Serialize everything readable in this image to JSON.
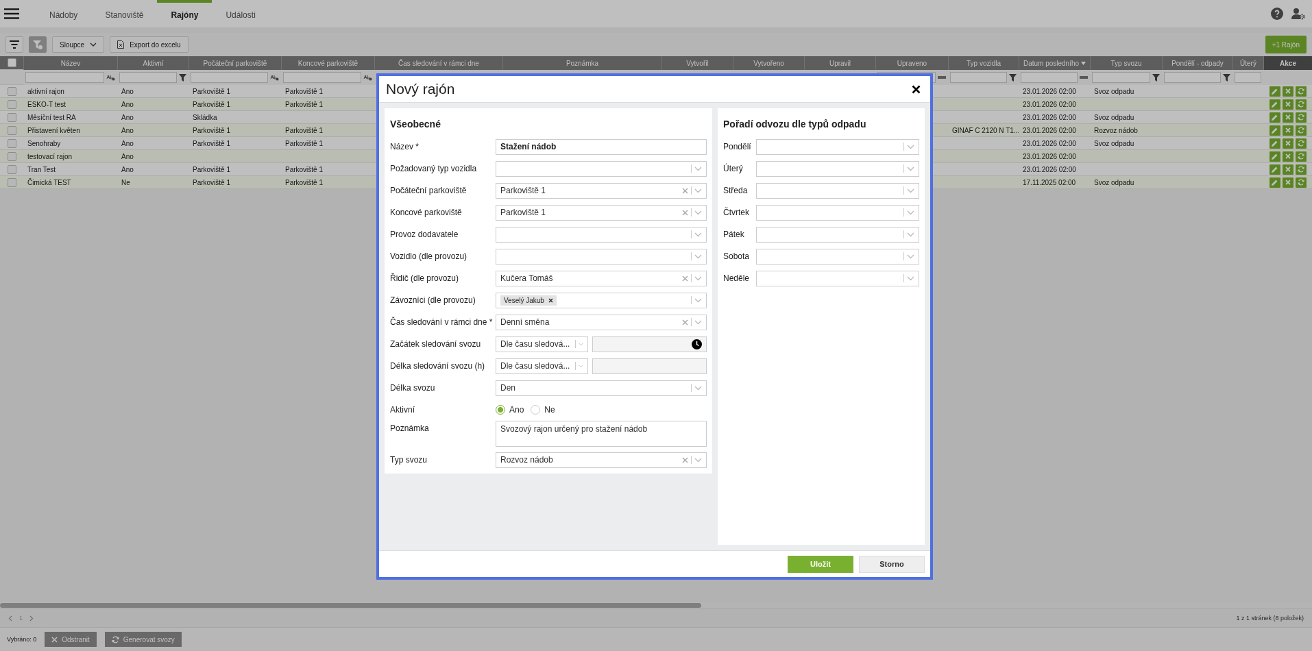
{
  "top_nav": {
    "tabs": [
      {
        "label": "Nádoby",
        "selected": false
      },
      {
        "label": "Stanoviště",
        "selected": false
      },
      {
        "label": "Rajóny",
        "selected": true
      },
      {
        "label": "Události",
        "selected": false
      }
    ]
  },
  "toolbar": {
    "clear_filter_disabled": true,
    "columns_button": "Sloupce",
    "export_button": "Export do excelu",
    "add_button": "+1 Rajón"
  },
  "table": {
    "select_all_checked": false,
    "columns": [
      {
        "label": "Název",
        "filter": {
          "kind": "text"
        }
      },
      {
        "label": "Aktivní",
        "filter": {
          "kind": "select"
        }
      },
      {
        "label": "Počáteční parkoviště",
        "filter": {
          "kind": "text"
        }
      },
      {
        "label": "Koncové parkoviště",
        "filter": {
          "kind": "text"
        }
      },
      {
        "label": "Čas sledování v rámci dne"
      },
      {
        "label": "Poznámka"
      },
      {
        "label": "Vytvořil"
      },
      {
        "label": "Vytvořeno"
      },
      {
        "label": "Upravil"
      },
      {
        "label": "Upraveno",
        "filter": {
          "kind": "date"
        }
      },
      {
        "label": "Typ vozidla",
        "filter": {
          "kind": "select"
        }
      },
      {
        "label": "Datum posledního",
        "filter": {
          "kind": "date"
        },
        "sorted_descending": true
      },
      {
        "label": "Typ svozu",
        "filter": {
          "kind": "select"
        }
      },
      {
        "label": "Pondělí - odpady",
        "filter": {
          "kind": "select"
        }
      },
      {
        "label": "Úterý",
        "filter": {
          "kind": "plain"
        }
      }
    ],
    "actions_label": "Akce",
    "rows": [
      {
        "checked": false,
        "name": "aktivní rajon",
        "active": "Ano",
        "start_parking": "Parkoviště 1",
        "end_parking": "Parkoviště 1",
        "last_date": "23.01.2026 02:00",
        "collection_type": "Svoz odpadu"
      },
      {
        "checked": false,
        "name": "ESKO-T test",
        "active": "Ano",
        "start_parking": "Parkoviště 1",
        "end_parking": "Parkoviště 1",
        "last_date": "23.01.2026 02:00"
      },
      {
        "checked": false,
        "name": "Měsíční test RA",
        "active": "Ano",
        "start_parking": "Skládka",
        "last_date": "23.01.2026 02:00",
        "collection_type": "Svoz odpadu"
      },
      {
        "checked": false,
        "name": "Přistavení květen",
        "active": "Ano",
        "start_parking": "Parkoviště 1",
        "end_parking": "Parkoviště 1",
        "vehicle_type": "GINAF C 2120 N T1...",
        "last_date": "23.01.2026 02:00",
        "collection_type": "Rozvoz nádob"
      },
      {
        "checked": false,
        "name": "Senohraby",
        "active": "Ano",
        "start_parking": "Parkoviště 1",
        "end_parking": "Parkoviště 1",
        "last_date": "23.01.2026 02:00",
        "collection_type": "Svoz odpadu"
      },
      {
        "checked": false,
        "name": "testovací rajon",
        "active": "Ano",
        "last_date": "23.01.2026 02:00"
      },
      {
        "checked": false,
        "name": "Tran Test",
        "active": "Ano",
        "start_parking": "Parkoviště 1",
        "end_parking": "Parkoviště 1",
        "last_date": "23.01.2026 02:00"
      },
      {
        "checked": false,
        "name": "Čimická TEST",
        "active": "Ne",
        "start_parking": "Parkoviště 1",
        "end_parking": "Parkoviště 1",
        "last_date": "17.11.2025 02:00",
        "collection_type": "Svoz odpadu"
      }
    ]
  },
  "pagination": {
    "page": "1",
    "summary": "1 z 1 stránek (8 položek)"
  },
  "footer": {
    "selected_label": "Vybráno: 0",
    "buttons": [
      {
        "label": "Odstranit",
        "kind": "delete",
        "disabled": true
      },
      {
        "label": "Generovat svozy",
        "kind": "generate",
        "disabled": true
      }
    ]
  },
  "modal": {
    "title": "Nový rajón",
    "sections": [
      {
        "title": "Všeobecné",
        "fields": [
          {
            "label": "Název *",
            "kind": "text",
            "value": "Stažení nádob"
          },
          {
            "label": "Požadovaný typ vozidla",
            "kind": "select"
          },
          {
            "label": "Počáteční parkoviště",
            "kind": "select",
            "value": "Parkoviště 1",
            "clearable": true
          },
          {
            "label": "Koncové parkoviště",
            "kind": "select",
            "value": "Parkoviště 1",
            "clearable": true
          },
          {
            "label": "Provoz dodavatele",
            "kind": "select"
          },
          {
            "label": "Vozidlo (dle provozu)",
            "kind": "select"
          },
          {
            "label": "Řidič (dle provozu)",
            "kind": "select",
            "value": "Kučera Tomáš",
            "clearable": true
          },
          {
            "label": "Závozníci (dle provozu)",
            "kind": "tags",
            "tags": [
              "Veselý Jakub"
            ]
          },
          {
            "label": "Čas sledování v rámci dne *",
            "kind": "select",
            "value": "Denní směna",
            "clearable": true
          },
          {
            "label": "Začátek sledování svozu",
            "kind": "time_split",
            "value": "Dle času sledová..."
          },
          {
            "label": "Délka sledování svozu (h)",
            "kind": "number_split",
            "value": "Dle času sledová..."
          },
          {
            "label": "Délka svozu",
            "kind": "select",
            "value": "Den",
            "clearable": false
          },
          {
            "label": "Aktivní",
            "kind": "radio",
            "options": [
              {
                "label": "Ano",
                "selected": true
              },
              {
                "label": "Ne",
                "selected": false
              }
            ]
          },
          {
            "label": "Poznámka",
            "kind": "textarea",
            "value": "Svozový rajon určený pro stažení nádob"
          },
          {
            "label": "Typ svozu",
            "kind": "select",
            "value": "Rozvoz nádob",
            "clearable": true
          }
        ]
      },
      {
        "title": "Pořadí odvozu dle typů odpadu",
        "fields": [
          {
            "label": "Pondělí",
            "kind": "select"
          },
          {
            "label": "Úterý",
            "kind": "select"
          },
          {
            "label": "Středa",
            "kind": "select"
          },
          {
            "label": "Čtvrtek",
            "kind": "select"
          },
          {
            "label": "Pátek",
            "kind": "select"
          },
          {
            "label": "Sobota",
            "kind": "select"
          },
          {
            "label": "Neděle",
            "kind": "select"
          }
        ]
      }
    ],
    "buttons": [
      {
        "label": "Uložit",
        "kind": "primary"
      },
      {
        "label": "Storno",
        "kind": "secondary"
      }
    ]
  }
}
